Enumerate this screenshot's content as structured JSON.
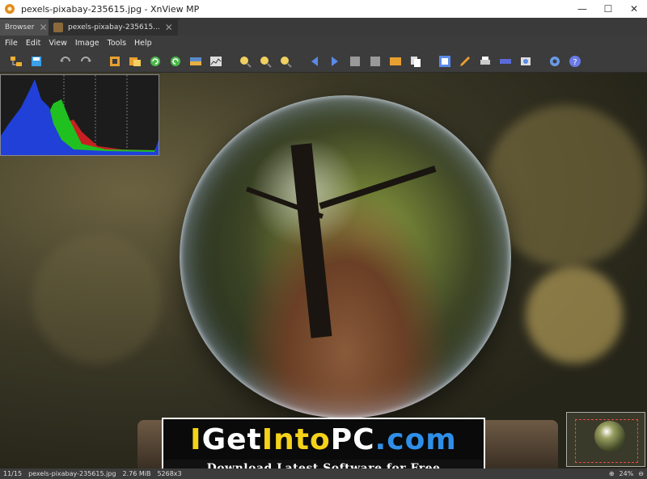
{
  "window": {
    "title": "pexels-pixabay-235615.jpg - XnView MP",
    "minimize": "—",
    "maximize": "☐",
    "close": "✕"
  },
  "tabs": [
    {
      "label": "Browser",
      "close": "✕"
    },
    {
      "label": "pexels-pixabay-235615...",
      "close": "✕"
    }
  ],
  "menu": [
    "File",
    "Edit",
    "View",
    "Image",
    "Tools",
    "Help"
  ],
  "toolbar": {
    "icons": [
      "folder-tree-icon",
      "save-icon",
      "undo-icon",
      "redo-icon",
      "crop-icon",
      "resize-icon",
      "rotate-left-icon",
      "rotate-right-icon",
      "adjust-icon",
      "histogram-icon",
      "zoom-in-icon",
      "zoom-fit-icon",
      "zoom-out-icon",
      "prev-icon",
      "next-icon",
      "first-icon",
      "last-icon",
      "slideshow-icon",
      "copy-icon",
      "fullscreen-icon",
      "edit-icon",
      "print-icon",
      "scanner-icon",
      "capture-icon",
      "settings-icon",
      "help-icon"
    ]
  },
  "banner": {
    "line1_a": "I",
    "line1_b": "Get",
    "line1_c": "Into",
    "line1_d": "PC",
    "line1_e": ".com",
    "line2": "Download Latest Software for Free"
  },
  "status": {
    "index": "11/15",
    "filename": "pexels-pixabay-235615.jpg",
    "filesize": "2.76 MiB",
    "dimensions": "5268x3",
    "zoom": "24%"
  },
  "colors": {
    "accent_yellow": "#f5d21a",
    "accent_blue": "#2f8fe8"
  }
}
